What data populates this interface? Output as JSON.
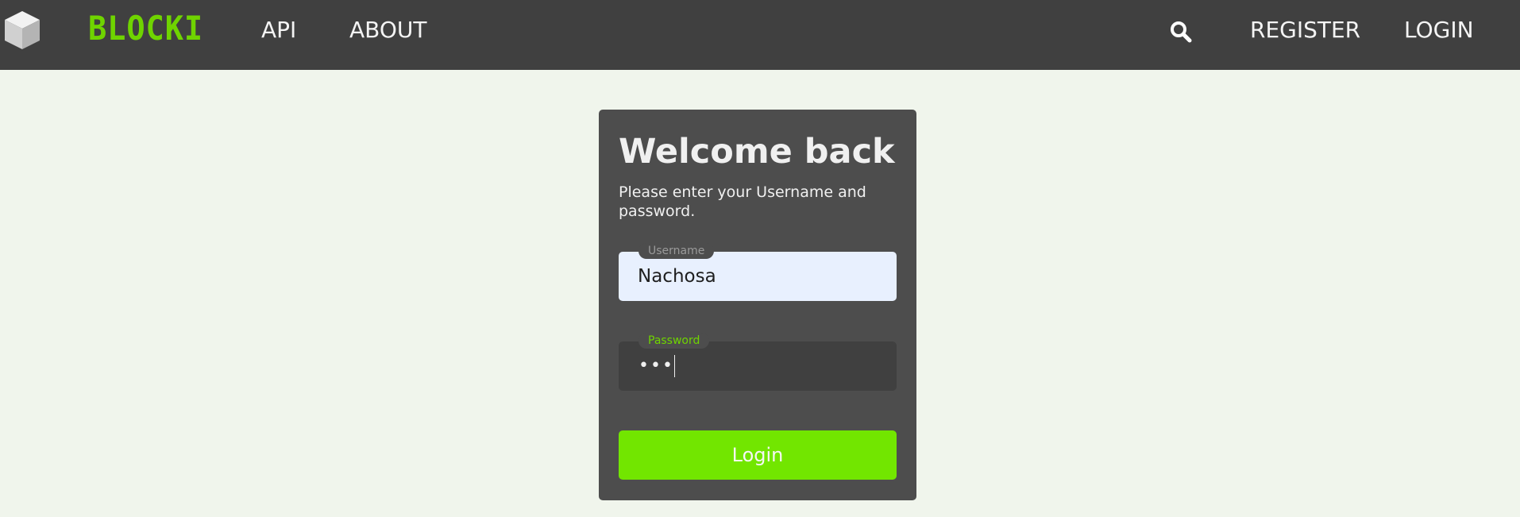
{
  "navbar": {
    "brand": "BLOCKI",
    "links": {
      "api": "API",
      "about": "ABOUT",
      "register": "REGISTER",
      "login": "LOGIN"
    },
    "search_icon": "search-icon",
    "background_color": "#404040",
    "brand_color": "#6fd400"
  },
  "login_card": {
    "title": "Welcome back",
    "subtitle": "Please enter your Username and password.",
    "username": {
      "label": "Username",
      "value": "Nachosa"
    },
    "password": {
      "label": "Password",
      "masked_value": "•••"
    },
    "submit_label": "Login",
    "accent_color": "#72e600"
  }
}
